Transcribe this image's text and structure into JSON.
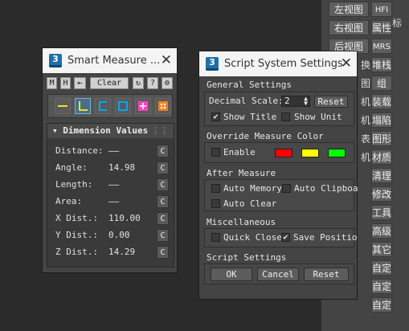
{
  "background_toolbar": {
    "buttons": [
      {
        "label": "左视图"
      },
      {
        "label": "HFI"
      },
      {
        "label": "右视图"
      },
      {
        "label": "属性"
      },
      {
        "label": "后视图"
      },
      {
        "label": "MRS"
      },
      {
        "label": "堆栈"
      },
      {
        "label": "组"
      },
      {
        "label": "装载"
      },
      {
        "label": "塌陷"
      },
      {
        "label": "图形"
      },
      {
        "label": "材质"
      },
      {
        "label": "清理"
      },
      {
        "label": "修改"
      },
      {
        "label": "工具"
      },
      {
        "label": "高级"
      },
      {
        "label": "其它"
      },
      {
        "label": "自定"
      },
      {
        "label": "自定"
      },
      {
        "label": "自定"
      }
    ],
    "fragments": [
      "换",
      "图",
      "机",
      "机",
      "表",
      "机"
    ],
    "top_fragment": "标"
  },
  "smart_measure": {
    "title": "Smart Measure ...",
    "icon_text": "3",
    "toolbar": {
      "m": "M",
      "h": "H",
      "arrow": "⇤",
      "clear": "Clear",
      "refresh": "↻",
      "help": "?",
      "settings": "⚙"
    },
    "tools": [
      {
        "name": "line-tool",
        "color": "#f0e020"
      },
      {
        "name": "angle-tool",
        "color": "#f0e020",
        "active": true
      },
      {
        "name": "bracket-tool",
        "color": "#00a8f0"
      },
      {
        "name": "square-tool",
        "color": "#00a8f0"
      },
      {
        "name": "cross-tool",
        "color": "#ff40c0"
      },
      {
        "name": "dots-tool",
        "color": "#f08020"
      }
    ],
    "panel_title": "Dimension Values",
    "rows": [
      {
        "label": "Distance:",
        "value": "——",
        "copy": "C"
      },
      {
        "label": "Angle:",
        "value": "14.98",
        "copy": "C"
      },
      {
        "label": "Length:",
        "value": "——",
        "copy": "C"
      },
      {
        "label": "Area:",
        "value": "——",
        "copy": "C"
      },
      {
        "label": "X Dist.:",
        "value": "110.00",
        "copy": "C"
      },
      {
        "label": "Y Dist.:",
        "value": "0.00",
        "copy": "C"
      },
      {
        "label": "Z Dist.:",
        "value": "14.29",
        "copy": "C"
      }
    ]
  },
  "settings": {
    "title": "Script System Settings",
    "icon_text": "3",
    "general": {
      "header": "General Settings",
      "decimal_label": "Decimal Scale:",
      "decimal_value": "2",
      "reset": "Reset",
      "show_title": "Show Title",
      "show_title_checked": true,
      "show_unit": "Show Unit",
      "show_unit_checked": false
    },
    "override": {
      "header": "Override Measure Color",
      "enable": "Enable",
      "colors": [
        "#ff0000",
        "#ffff00",
        "#00ff00"
      ]
    },
    "after": {
      "header": "After Measure",
      "auto_memory": "Auto Memory",
      "auto_clipboard": "Auto Clipboa",
      "auto_clear": "Auto Clear"
    },
    "misc": {
      "header": "Miscellaneous",
      "quick_close": "Quick Close",
      "save_position": "Save Positio",
      "save_position_checked": true
    },
    "script": {
      "header": "Script Settings",
      "ok": "OK",
      "cancel": "Cancel",
      "reset": "Reset"
    }
  }
}
